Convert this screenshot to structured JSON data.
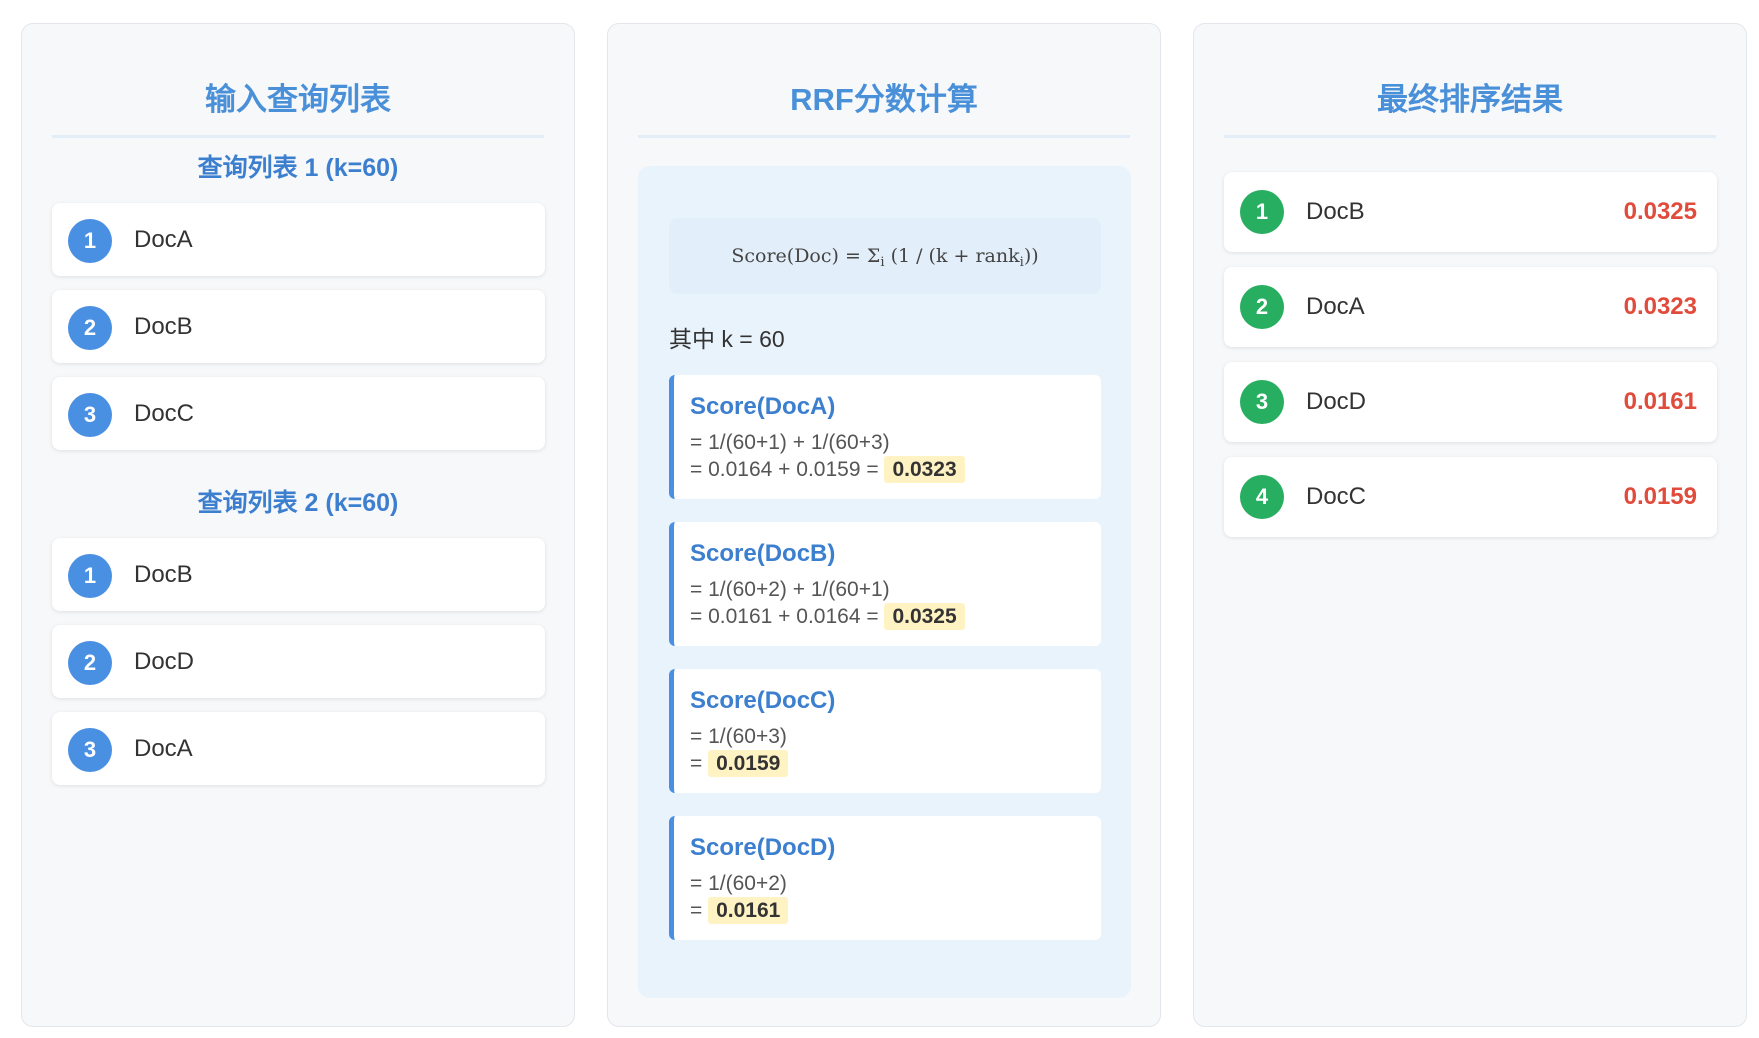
{
  "input_panel": {
    "title": "输入查询列表",
    "lists": [
      {
        "subtitle": "查询列表 1 (k=60)",
        "items": [
          {
            "rank": "1",
            "doc": "DocA"
          },
          {
            "rank": "2",
            "doc": "DocB"
          },
          {
            "rank": "3",
            "doc": "DocC"
          }
        ]
      },
      {
        "subtitle": "查询列表 2 (k=60)",
        "items": [
          {
            "rank": "1",
            "doc": "DocB"
          },
          {
            "rank": "2",
            "doc": "DocD"
          },
          {
            "rank": "3",
            "doc": "DocA"
          }
        ]
      }
    ]
  },
  "calc_panel": {
    "title": "RRF分数计算",
    "formula": {
      "lhs": "Score(Doc) = Σ",
      "sum_index": "i",
      "middle": " (1 / (k + rank",
      "rank_index": "i",
      "rhs": "))"
    },
    "where_text": "其中 k = 60",
    "scores": [
      {
        "title": "Score(DocA)",
        "line1": "= 1/(60+1) + 1/(60+3)",
        "line2_prefix": "= 0.0164 + 0.0159 =",
        "result": "0.0323"
      },
      {
        "title": "Score(DocB)",
        "line1": "= 1/(60+2) + 1/(60+1)",
        "line2_prefix": "= 0.0161 + 0.0164 =",
        "result": "0.0325"
      },
      {
        "title": "Score(DocC)",
        "line1": "= 1/(60+3)",
        "line2_prefix": "=",
        "result": "0.0159"
      },
      {
        "title": "Score(DocD)",
        "line1": "= 1/(60+2)",
        "line2_prefix": "=",
        "result": "0.0161"
      }
    ]
  },
  "results_panel": {
    "title": "最终排序结果",
    "items": [
      {
        "rank": "1",
        "doc": "DocB",
        "score": "0.0325"
      },
      {
        "rank": "2",
        "doc": "DocA",
        "score": "0.0323"
      },
      {
        "rank": "3",
        "doc": "DocD",
        "score": "0.0161"
      },
      {
        "rank": "4",
        "doc": "DocC",
        "score": "0.0159"
      }
    ]
  },
  "colors": {
    "title_blue": "#4a90d9",
    "badge_blue": "#4a90e2",
    "badge_green": "#27ae60",
    "score_red": "#e14b3b",
    "highlight_yellow": "#fff3c4"
  }
}
